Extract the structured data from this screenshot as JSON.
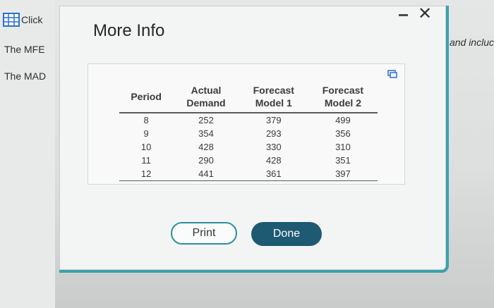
{
  "background": {
    "click_label": "Click",
    "lines": [
      "The MFE",
      "The MAD"
    ],
    "right_text": "and incluc"
  },
  "dialog": {
    "title": "More Info",
    "table": {
      "headers": [
        [
          "Period"
        ],
        [
          "Actual",
          "Demand"
        ],
        [
          "Forecast",
          "Model 1"
        ],
        [
          "Forecast",
          "Model 2"
        ]
      ],
      "rows": [
        [
          "8",
          "252",
          "379",
          "499"
        ],
        [
          "9",
          "354",
          "293",
          "356"
        ],
        [
          "10",
          "428",
          "330",
          "310"
        ],
        [
          "11",
          "290",
          "428",
          "351"
        ],
        [
          "12",
          "441",
          "361",
          "397"
        ]
      ]
    },
    "buttons": {
      "print": "Print",
      "done": "Done"
    }
  },
  "colors": {
    "accent": "#3aa2ae",
    "done_bg": "#1e5a72",
    "icon_blue": "#2a6fd6"
  }
}
